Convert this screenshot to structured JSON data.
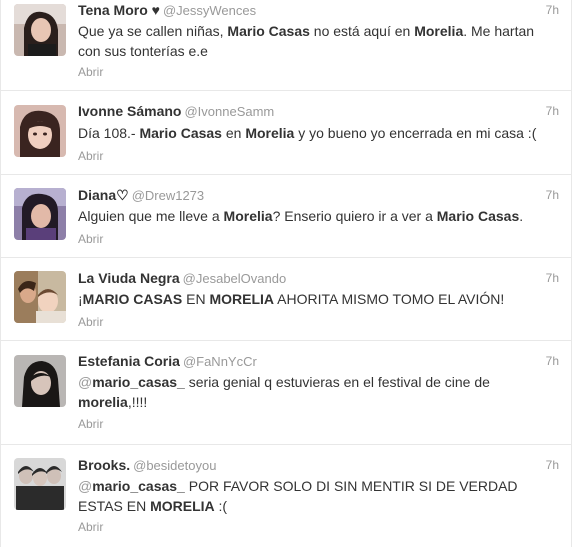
{
  "tweets": [
    {
      "fullname": "Tena Moro ♥",
      "username": "@JessyWences",
      "time": "7h",
      "parts": [
        "Que ya se callen niñas, ",
        "Mario Casas",
        " no está aquí en ",
        "Morelia",
        ". Me hartan con sus tonterías e.e"
      ],
      "open": "Abrir"
    },
    {
      "fullname": "Ivonne Sámano",
      "username": "@IvonneSamm",
      "time": "7h",
      "parts": [
        "Día 108.- ",
        "Mario Casas",
        " en ",
        "Morelia",
        " y yo bueno yo encerrada en mi casa :("
      ],
      "open": "Abrir"
    },
    {
      "fullname": "Diana♡",
      "username": "@Drew1273",
      "time": "7h",
      "parts": [
        "Alguien que me lleve a ",
        "Morelia",
        "? Enserio quiero ir a ver a ",
        "Mario Casas",
        "."
      ],
      "open": "Abrir"
    },
    {
      "fullname": "La Viuda Negra",
      "username": "@JesabelOvando",
      "time": "7h",
      "parts": [
        "¡",
        "MARIO CASAS",
        " EN ",
        "MORELIA",
        " AHORITA MISMO TOMO EL AVIÓN!"
      ],
      "open": "Abrir"
    },
    {
      "fullname": "Estefania Coria",
      "username": "@FaNnYcCr",
      "time": "7h",
      "mention_at": "@",
      "mention_user": "mario_casas_",
      "parts": [
        " seria genial q estuvieras en el festival de cine de ",
        "morelia",
        ",!!!!"
      ],
      "open": "Abrir"
    },
    {
      "fullname": "Brooks.",
      "username": "@besidetoyou",
      "time": "7h",
      "mention_at": "@",
      "mention_user": "mario_casas_",
      "parts": [
        " POR FAVOR SOLO DI SIN MENTIR SI DE VERDAD ESTAS EN ",
        "MORELIA",
        " :("
      ],
      "open": "Abrir"
    }
  ],
  "colors": {
    "text": "#333333",
    "muted": "#999999",
    "divider": "#e8e8e8"
  }
}
